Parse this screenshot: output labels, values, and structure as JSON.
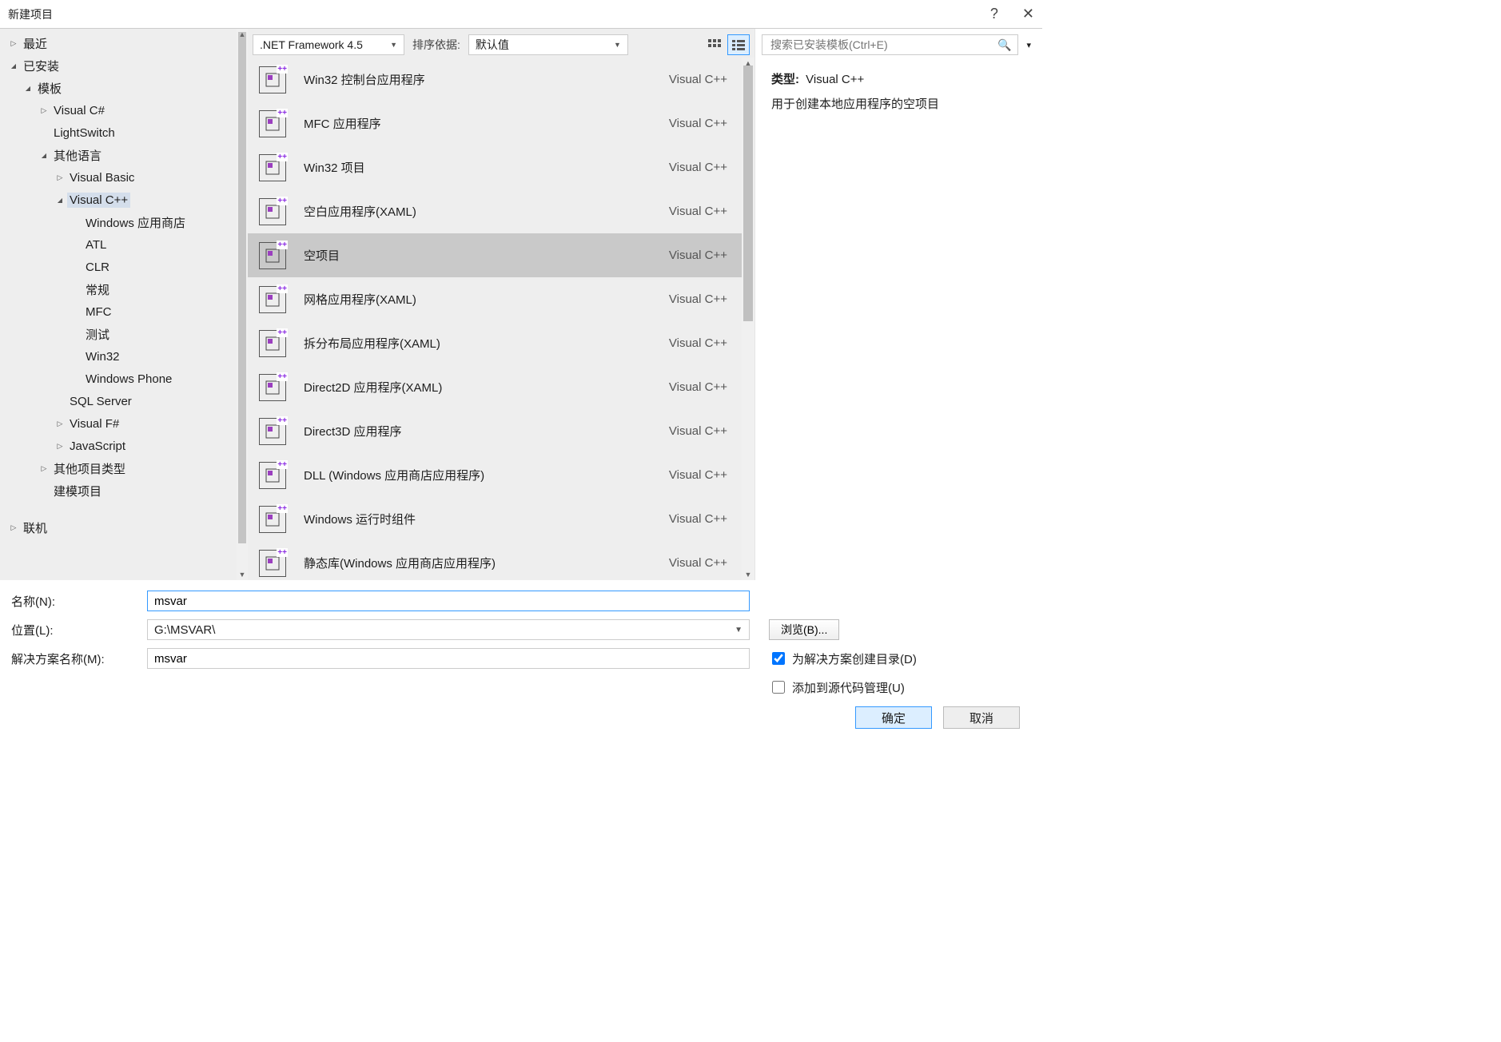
{
  "title": "新建项目",
  "help": "?",
  "tree": [
    {
      "label": "最近",
      "level": 0,
      "arrow": "closed"
    },
    {
      "label": "已安装",
      "level": 0,
      "arrow": "open"
    },
    {
      "label": "模板",
      "level": 1,
      "arrow": "open"
    },
    {
      "label": "Visual C#",
      "level": 2,
      "arrow": "closed"
    },
    {
      "label": "LightSwitch",
      "level": 2,
      "arrow": ""
    },
    {
      "label": "其他语言",
      "level": 2,
      "arrow": "open"
    },
    {
      "label": "Visual Basic",
      "level": 3,
      "arrow": "closed"
    },
    {
      "label": "Visual C++",
      "level": 3,
      "arrow": "open",
      "selected": true
    },
    {
      "label": "Windows 应用商店",
      "level": 4,
      "arrow": ""
    },
    {
      "label": "ATL",
      "level": 4,
      "arrow": ""
    },
    {
      "label": "CLR",
      "level": 4,
      "arrow": ""
    },
    {
      "label": "常规",
      "level": 4,
      "arrow": ""
    },
    {
      "label": "MFC",
      "level": 4,
      "arrow": ""
    },
    {
      "label": "测试",
      "level": 4,
      "arrow": ""
    },
    {
      "label": "Win32",
      "level": 4,
      "arrow": ""
    },
    {
      "label": "Windows Phone",
      "level": 4,
      "arrow": ""
    },
    {
      "label": "SQL Server",
      "level": 3,
      "arrow": ""
    },
    {
      "label": "Visual F#",
      "level": 3,
      "arrow": "closed"
    },
    {
      "label": "JavaScript",
      "level": 3,
      "arrow": "closed"
    },
    {
      "label": "其他项目类型",
      "level": 2,
      "arrow": "closed"
    },
    {
      "label": "建模项目",
      "level": 2,
      "arrow": ""
    },
    {
      "label": "联机",
      "level": 0,
      "arrow": "closed"
    }
  ],
  "toolbar": {
    "framework": ".NET Framework 4.5",
    "sort_label": "排序依据:",
    "sort_value": "默认值"
  },
  "templates": [
    {
      "name": "Win32 控制台应用程序",
      "lang": "Visual C++"
    },
    {
      "name": "MFC 应用程序",
      "lang": "Visual C++"
    },
    {
      "name": "Win32 项目",
      "lang": "Visual C++"
    },
    {
      "name": "空白应用程序(XAML)",
      "lang": "Visual C++"
    },
    {
      "name": "空项目",
      "lang": "Visual C++",
      "selected": true
    },
    {
      "name": "网格应用程序(XAML)",
      "lang": "Visual C++"
    },
    {
      "name": "拆分布局应用程序(XAML)",
      "lang": "Visual C++"
    },
    {
      "name": "Direct2D 应用程序(XAML)",
      "lang": "Visual C++"
    },
    {
      "name": "Direct3D 应用程序",
      "lang": "Visual C++"
    },
    {
      "name": "DLL (Windows 应用商店应用程序)",
      "lang": "Visual C++"
    },
    {
      "name": "Windows 运行时组件",
      "lang": "Visual C++"
    },
    {
      "name": "静态库(Windows 应用商店应用程序)",
      "lang": "Visual C++"
    }
  ],
  "search": {
    "placeholder": "搜索已安装模板(Ctrl+E)"
  },
  "info": {
    "type_label": "类型:",
    "type_value": "Visual C++",
    "description": "用于创建本地应用程序的空项目"
  },
  "form": {
    "name_label": "名称(N):",
    "name_value": "msvar",
    "location_label": "位置(L):",
    "location_value": "G:\\MSVAR\\",
    "browse_label": "浏览(B)...",
    "solution_label": "解决方案名称(M):",
    "solution_value": "msvar",
    "create_dir_label": "为解决方案创建目录(D)",
    "create_dir_checked": true,
    "add_source_label": "添加到源代码管理(U)",
    "add_source_checked": false
  },
  "buttons": {
    "ok": "确定",
    "cancel": "取消"
  }
}
